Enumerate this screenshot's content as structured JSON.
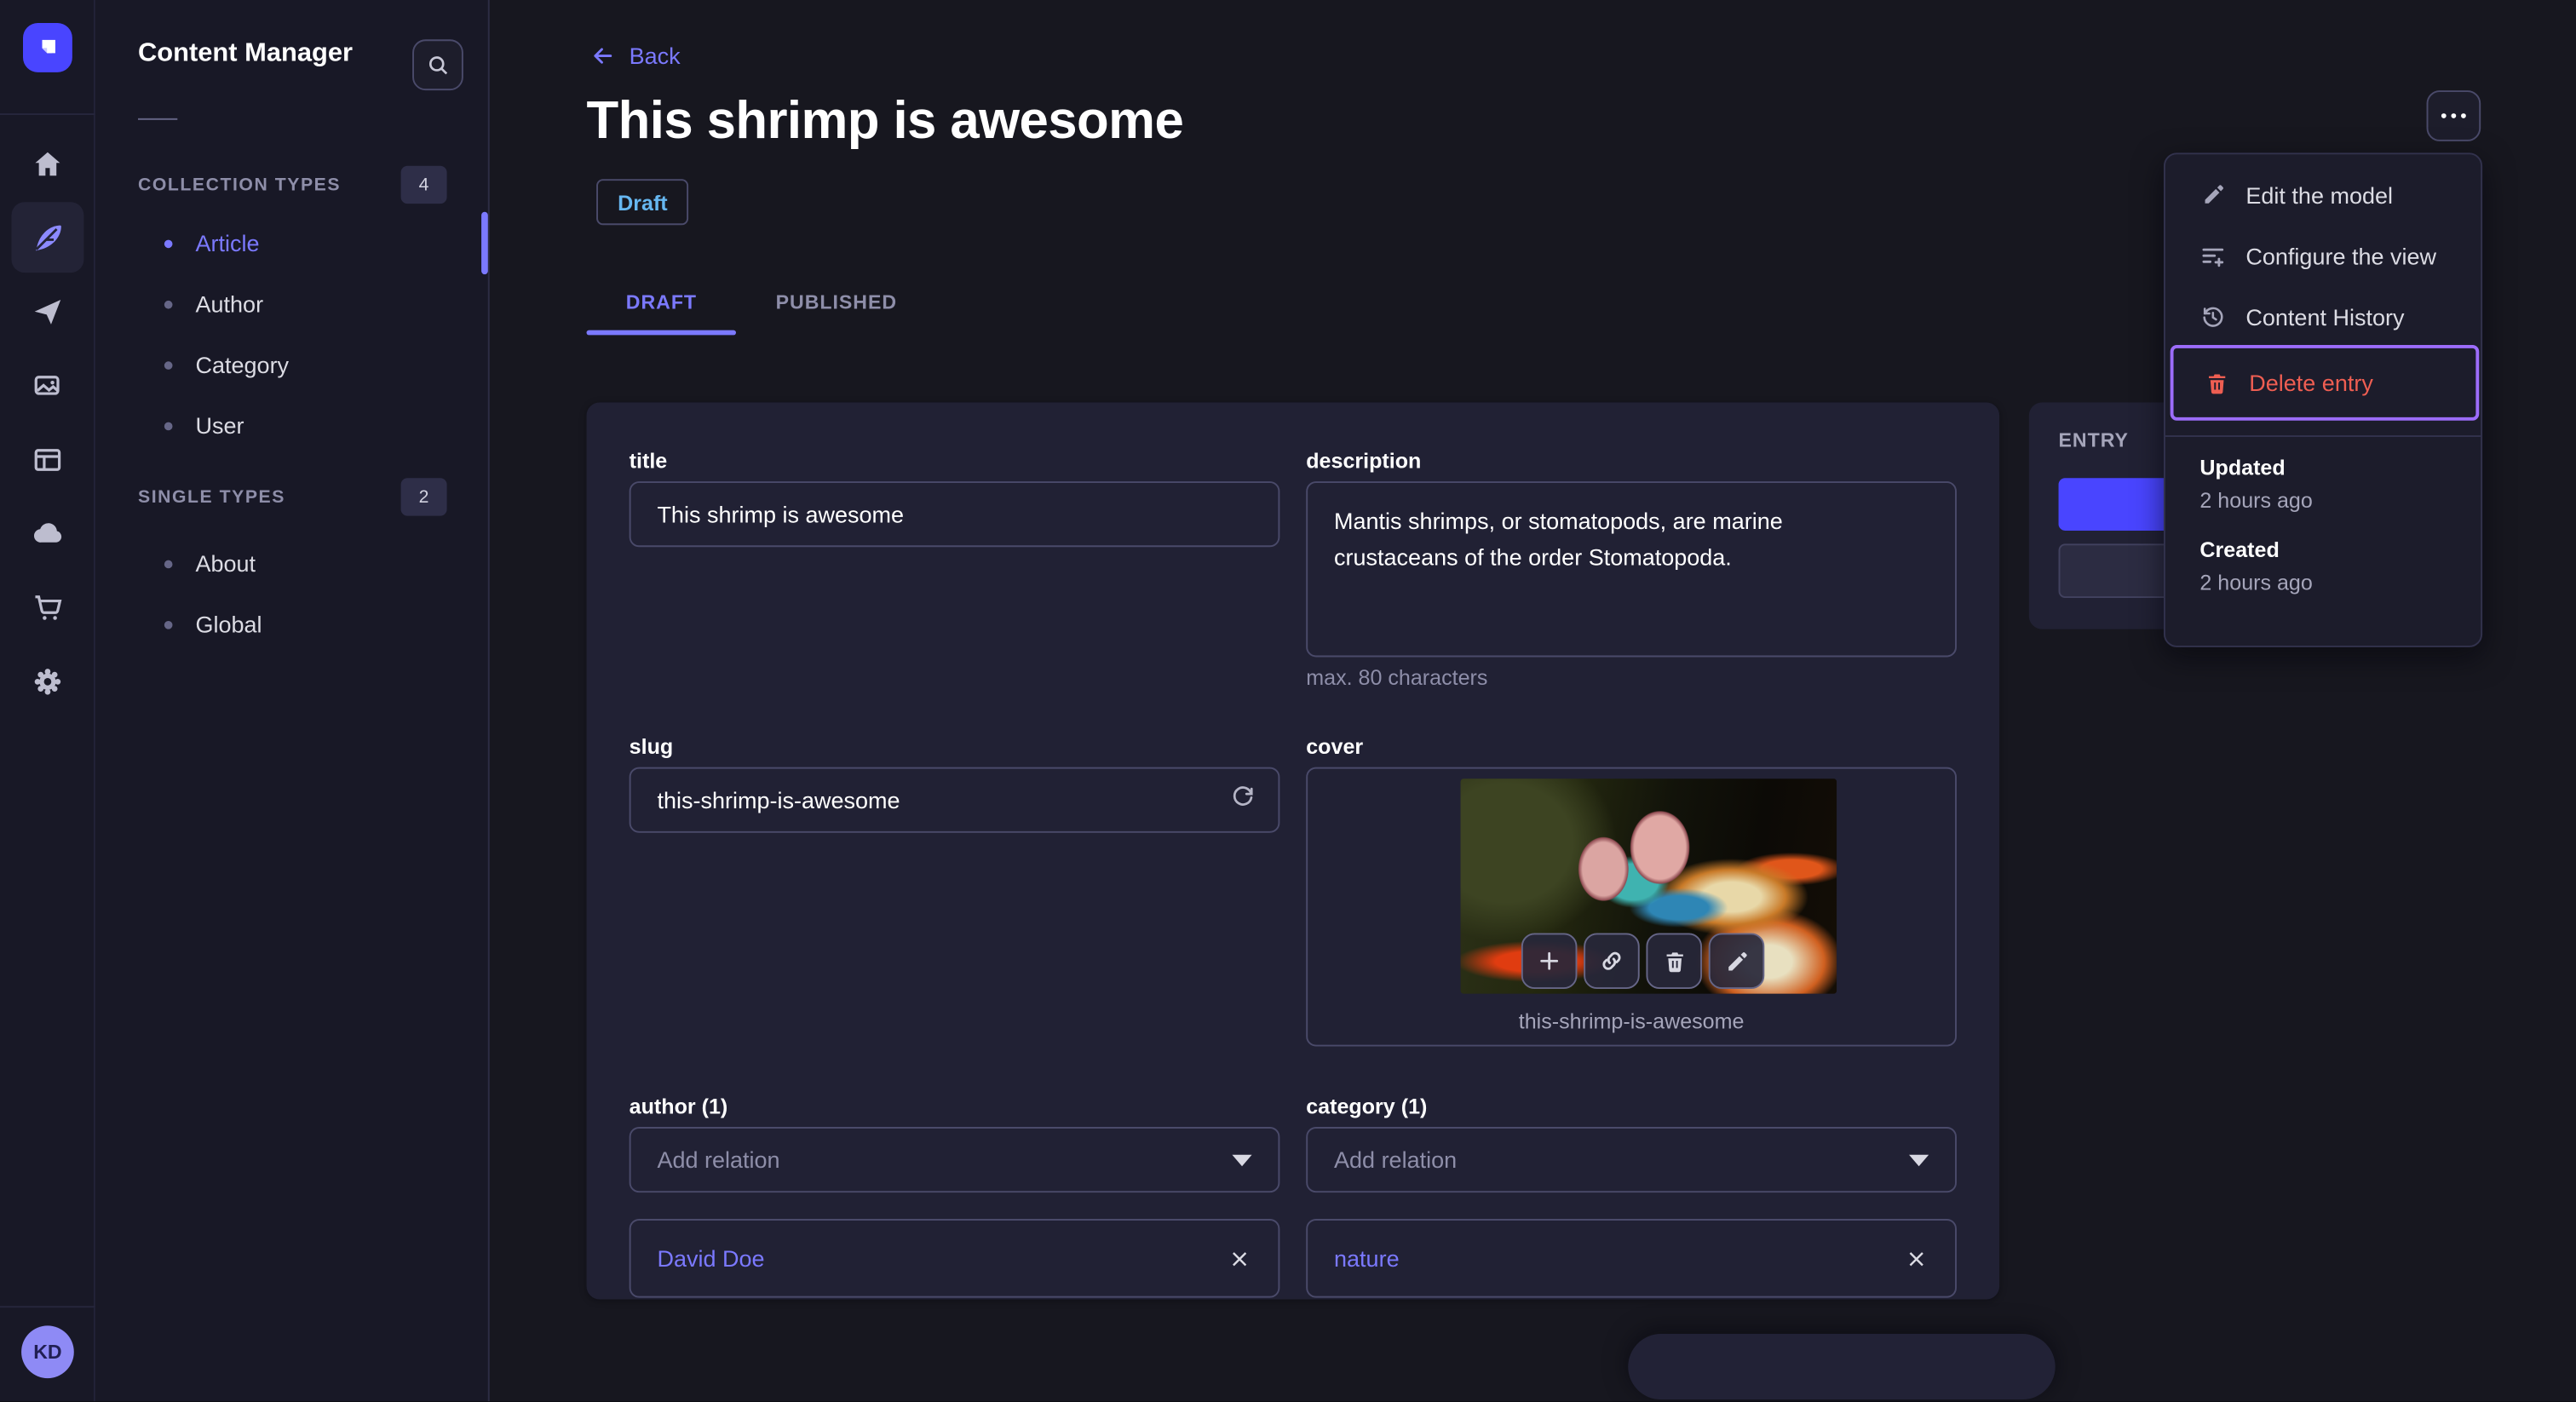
{
  "app": {
    "title": "Content Manager",
    "user_initials": "KD"
  },
  "rail": {
    "icons": [
      "home-icon",
      "content-builder-feather-icon",
      "send-icon",
      "media-library-icon",
      "layout-icon",
      "cloud-icon",
      "marketplace-cart-icon",
      "settings-gear-icon"
    ]
  },
  "subnav": {
    "title": "Content Manager",
    "sections": [
      {
        "label": "COLLECTION TYPES",
        "count": "4",
        "items": [
          {
            "label": "Article"
          },
          {
            "label": "Author"
          },
          {
            "label": "Category"
          },
          {
            "label": "User"
          }
        ]
      },
      {
        "label": "SINGLE TYPES",
        "count": "2",
        "items": [
          {
            "label": "About"
          },
          {
            "label": "Global"
          }
        ]
      }
    ]
  },
  "header": {
    "back_label": "Back",
    "title": "This shrimp is awesome",
    "status": "Draft",
    "tabs": [
      {
        "label": "DRAFT"
      },
      {
        "label": "PUBLISHED"
      }
    ]
  },
  "form": {
    "title": {
      "label": "title",
      "value": "This shrimp is awesome"
    },
    "description": {
      "label": "description",
      "value": "Mantis shrimps, or stomatopods, are marine crustaceans of the order Stomatopoda.",
      "hint": "max. 80 characters"
    },
    "slug": {
      "label": "slug",
      "value": "this-shrimp-is-awesome"
    },
    "cover": {
      "label": "cover",
      "caption": "this-shrimp-is-awesome"
    },
    "author": {
      "label": "author (1)",
      "placeholder": "Add relation",
      "selected": "David Doe"
    },
    "category": {
      "label": "category (1)",
      "placeholder": "Add relation",
      "selected": "nature"
    }
  },
  "entry_panel": {
    "title": "ENTRY"
  },
  "menu": {
    "items": [
      {
        "label": "Edit the model"
      },
      {
        "label": "Configure the view"
      },
      {
        "label": "Content History"
      },
      {
        "label": "Delete entry"
      }
    ],
    "updated_label": "Updated",
    "updated_value": "2 hours ago",
    "created_label": "Created",
    "created_value": "2 hours ago"
  },
  "colors": {
    "primary": "#4945ff",
    "primary_light": "#7b79ff",
    "focus_ring": "#9c6cfa",
    "danger": "#ee5e52",
    "draft_blue": "#66b7f1",
    "card_bg": "#212134",
    "page_bg": "#17171f",
    "sidebar_bg": "#181826"
  }
}
